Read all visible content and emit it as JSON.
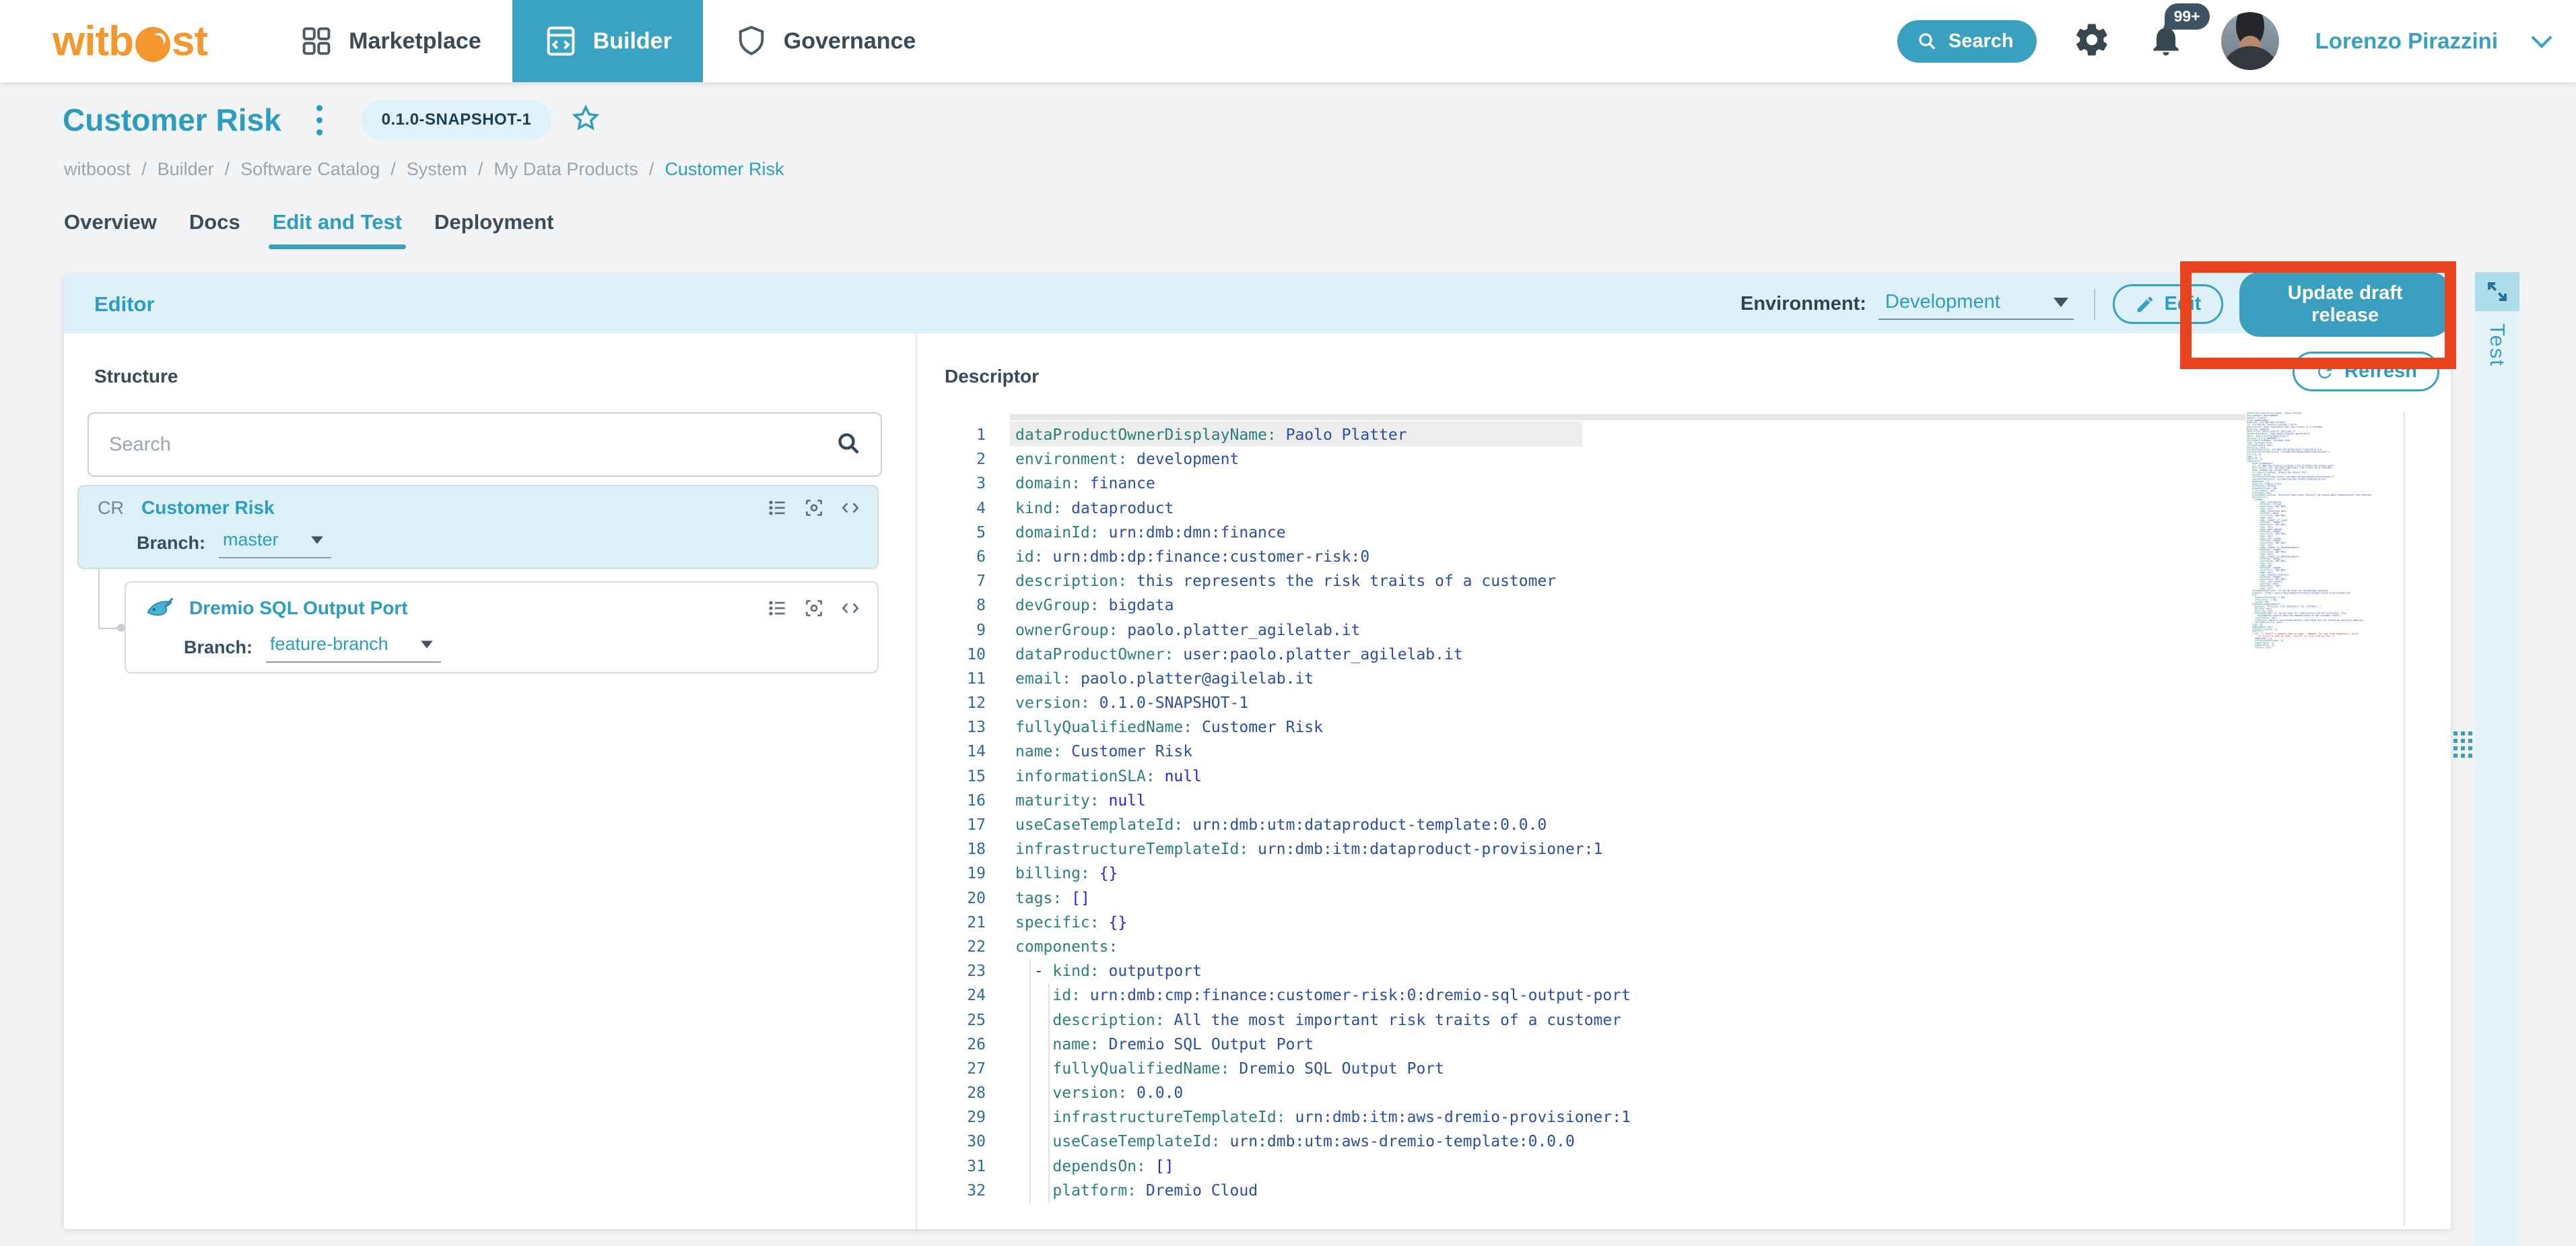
{
  "accent_color": "#3aa0bf",
  "annotation_color": "#e8431d",
  "header": {
    "logo": {
      "part1": "witb",
      "part2": "st"
    },
    "nav": [
      {
        "label": "Marketplace",
        "icon": "grid-icon",
        "active": false
      },
      {
        "label": "Builder",
        "icon": "window-code-icon",
        "active": true
      },
      {
        "label": "Governance",
        "icon": "shield-icon",
        "active": false
      }
    ],
    "search_label": "Search",
    "notifications_badge": "99+",
    "user_name": "Lorenzo Pirazzini"
  },
  "page": {
    "title": "Customer Risk",
    "version_badge": "0.1.0-SNAPSHOT-1",
    "breadcrumb": [
      "witboost",
      "Builder",
      "Software Catalog",
      "System",
      "My Data Products",
      "Customer Risk"
    ],
    "tabs": [
      {
        "label": "Overview",
        "active": false
      },
      {
        "label": "Docs",
        "active": false
      },
      {
        "label": "Edit and Test",
        "active": true
      },
      {
        "label": "Deployment",
        "active": false
      }
    ]
  },
  "editor_bar": {
    "title": "Editor",
    "environment_label": "Environment:",
    "environment_value": "Development",
    "edit_button": "Edit",
    "update_button": "Update draft release"
  },
  "structure": {
    "title": "Structure",
    "search_placeholder": "Search",
    "items": [
      {
        "prefix": "CR",
        "icon": "",
        "name": "Customer Risk",
        "branch_label": "Branch:",
        "branch": "master",
        "selected": true
      },
      {
        "prefix": "",
        "icon": "dremio-narwhal-icon",
        "name": "Dremio SQL Output Port",
        "branch_label": "Branch:",
        "branch": "feature-branch",
        "selected": false
      }
    ]
  },
  "descriptor": {
    "title": "Descriptor",
    "refresh_button": "Refresh"
  },
  "test_panel": {
    "tab_label": "Test"
  },
  "code_lines": [
    {
      "indent": 0,
      "dash": false,
      "key": "dataProductOwnerDisplayName",
      "value": "Paolo Platter",
      "special": false
    },
    {
      "indent": 0,
      "dash": false,
      "key": "environment",
      "value": "development",
      "special": false
    },
    {
      "indent": 0,
      "dash": false,
      "key": "domain",
      "value": "finance",
      "special": false
    },
    {
      "indent": 0,
      "dash": false,
      "key": "kind",
      "value": "dataproduct",
      "special": false
    },
    {
      "indent": 0,
      "dash": false,
      "key": "domainId",
      "value": "urn:dmb:dmn:finance",
      "special": false
    },
    {
      "indent": 0,
      "dash": false,
      "key": "id",
      "value": "urn:dmb:dp:finance:customer-risk:0",
      "special": false
    },
    {
      "indent": 0,
      "dash": false,
      "key": "description",
      "value": "this represents the risk traits of a customer",
      "special": false
    },
    {
      "indent": 0,
      "dash": false,
      "key": "devGroup",
      "value": "bigdata",
      "special": false
    },
    {
      "indent": 0,
      "dash": false,
      "key": "ownerGroup",
      "value": "paolo.platter_agilelab.it",
      "special": false
    },
    {
      "indent": 0,
      "dash": false,
      "key": "dataProductOwner",
      "value": "user:paolo.platter_agilelab.it",
      "special": false
    },
    {
      "indent": 0,
      "dash": false,
      "key": "email",
      "value": "paolo.platter@agilelab.it",
      "special": false
    },
    {
      "indent": 0,
      "dash": false,
      "key": "version",
      "value": "0.1.0-SNAPSHOT-1",
      "special": false
    },
    {
      "indent": 0,
      "dash": false,
      "key": "fullyQualifiedName",
      "value": "Customer Risk",
      "special": false
    },
    {
      "indent": 0,
      "dash": false,
      "key": "name",
      "value": "Customer Risk",
      "special": false
    },
    {
      "indent": 0,
      "dash": false,
      "key": "informationSLA",
      "value": "null",
      "special": true
    },
    {
      "indent": 0,
      "dash": false,
      "key": "maturity",
      "value": "null",
      "special": true
    },
    {
      "indent": 0,
      "dash": false,
      "key": "useCaseTemplateId",
      "value": "urn:dmb:utm:dataproduct-template:0.0.0",
      "special": false
    },
    {
      "indent": 0,
      "dash": false,
      "key": "infrastructureTemplateId",
      "value": "urn:dmb:itm:dataproduct-provisioner:1",
      "special": false
    },
    {
      "indent": 0,
      "dash": false,
      "key": "billing",
      "value": "{}",
      "special": true
    },
    {
      "indent": 0,
      "dash": false,
      "key": "tags",
      "value": "[]",
      "special": true
    },
    {
      "indent": 0,
      "dash": false,
      "key": "specific",
      "value": "{}",
      "special": true
    },
    {
      "indent": 0,
      "dash": false,
      "key": "components",
      "value": "",
      "special": false
    },
    {
      "indent": 2,
      "dash": true,
      "key": "kind",
      "value": "outputport",
      "special": false
    },
    {
      "indent": 4,
      "dash": false,
      "key": "id",
      "value": "urn:dmb:cmp:finance:customer-risk:0:dremio-sql-output-port",
      "special": false
    },
    {
      "indent": 4,
      "dash": false,
      "key": "description",
      "value": "All the most important risk traits of a customer",
      "special": false
    },
    {
      "indent": 4,
      "dash": false,
      "key": "name",
      "value": "Dremio SQL Output Port",
      "special": false
    },
    {
      "indent": 4,
      "dash": false,
      "key": "fullyQualifiedName",
      "value": "Dremio SQL Output Port",
      "special": false
    },
    {
      "indent": 4,
      "dash": false,
      "key": "version",
      "value": "0.0.0",
      "special": false
    },
    {
      "indent": 4,
      "dash": false,
      "key": "infrastructureTemplateId",
      "value": "urn:dmb:itm:aws-dremio-provisioner:1",
      "special": false
    },
    {
      "indent": 4,
      "dash": false,
      "key": "useCaseTemplateId",
      "value": "urn:dmb:utm:aws-dremio-template:0.0.0",
      "special": false
    },
    {
      "indent": 4,
      "dash": false,
      "key": "dependsOn",
      "value": "[]",
      "special": true
    },
    {
      "indent": 4,
      "dash": false,
      "key": "platform",
      "value": "Dremio Cloud",
      "special": false
    }
  ],
  "minimap_extra": [
    "    technology: Dremio",
    "    outputPortType: SQL",
    "    creationDate: null",
    "    startDate: null",
    "    processDescription: Starting from credit history, we consolidate standardized risk features",
    "    dataContract:",
    "      schema:",
    "        - name: customerId",
    "          dataType: string",
    "          constraint: NOT_NULL",
    "          tags: null",
    "        - name: reference_date",
    "          dataType: date",
    "          constraint: NOT_NULL",
    "          tags: null",
    "        - name: number_of_loans",
    "          dataType: number",
    "          constraint: NOT_NULL",
    "          tags: null",
    "        - name: debt_amount",
    "          dataType: number",
    "          constraint: NOT_NULL",
    "          tags: null",
    "        - name: net_income",
    "          dataType: number",
    "          constraint: NOT_NULL",
    "          tags: null",
    "        - name: number_of_30latepayments",
    "          dataType: number",
    "          constraint: NOT_NULL",
    "          tags: null",
    "        - name: number_of_60latepayments",
    "          dataType: number",
    "          constraint: NOT_NULL",
    "          tags: null",
    "        - name: age",
    "          dataType: number",
    "          constraint: NOT_NULL",
    "          tags: null",
    "        - name: mybank_riskscore",
    "          dataType: number",
    "          constraint: NOT_NULL",
    "        - name: last_update",
    "          dataType: date",
    "          constraint: null",
    "          tags: null",
    "    termsAndConditions: It can be used for production purposes",
    "    endpoint: https://myurl/development/finance/customerrisk/0.0.0/customerrisk",
    "    SLA:",
    "      intervalOfChange: 1 day",
    "      timeliness: 1 day",
    "      upTime: 99%",
    "    dataSharingAgreements:",
    "      purpose: \"Official risk indicators for customers. \"",
    "      billing: null",
    "      security: null",
    "      intendedUsage: It can be used for underwriting and KYC processes. This",
    "        information should never be communicated to the customer itself",
    "      limitations: null",
    "      lifeCycle: data is calculated monthly and there are not retention policies applied",
    "      confidentiality: null",
    "    tags: []",
    "    sampleData: null",
    "    semanticLinking: []",
    "    specific:",
    {
      "t": "      sql: \"> SELECT c.company_name as name, 'company' as type from companies c union",
      "red": true
    },
    {
      "t": "        all select p.name as name, 'person' as type from persons p\"",
      "red": true
    },
    "      dependsOn: []",
    "      reflectionSettings: []",
    "      supportSLAs: []",
    "      supportPIIs: []",
    "      formats: null"
  ]
}
